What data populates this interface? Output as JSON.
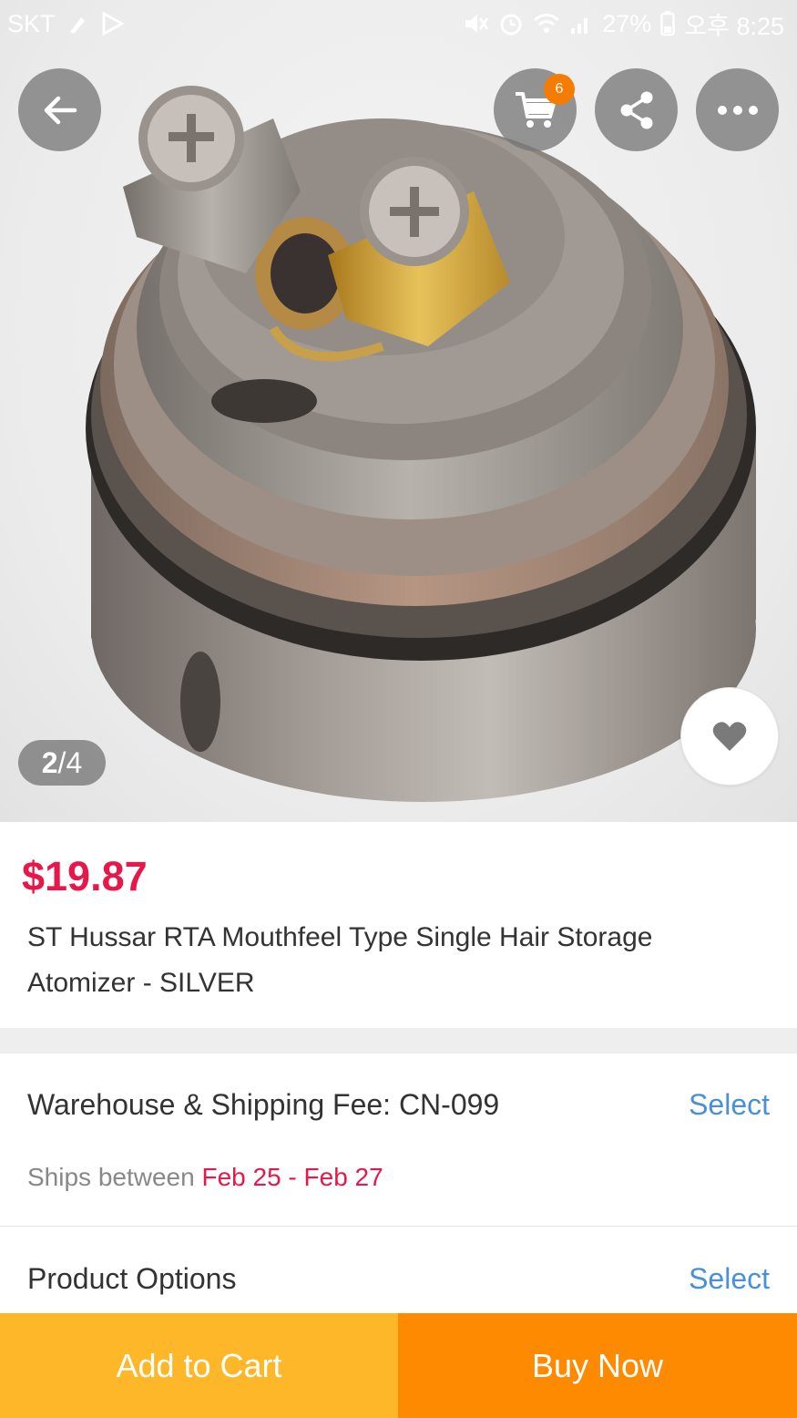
{
  "status_bar": {
    "carrier": "SKT",
    "battery": "27%",
    "time": "오후 8:25"
  },
  "gallery": {
    "current": "2",
    "total": "/4",
    "image_icon": "product-photo-atomizer-base"
  },
  "header": {
    "cart_count": "6"
  },
  "product": {
    "price": "$19.87",
    "title": "ST Hussar RTA Mouthfeel Type Single Hair Storage Atomizer - SILVER"
  },
  "shipping": {
    "label": "Warehouse & Shipping Fee:  CN-099",
    "select": "Select",
    "ships_prefix": "Ships between ",
    "ships_dates": "Feb 25 - Feb 27"
  },
  "options": {
    "label": "Product Options",
    "select": "Select"
  },
  "actions": {
    "add_to_cart": "Add to Cart",
    "buy_now": "Buy Now"
  },
  "colors": {
    "price": "#e8174a",
    "link": "#4a90d9",
    "add_to_cart_bg": "#fdb728",
    "buy_now_bg": "#fd8a00",
    "badge": "#f57c00"
  }
}
